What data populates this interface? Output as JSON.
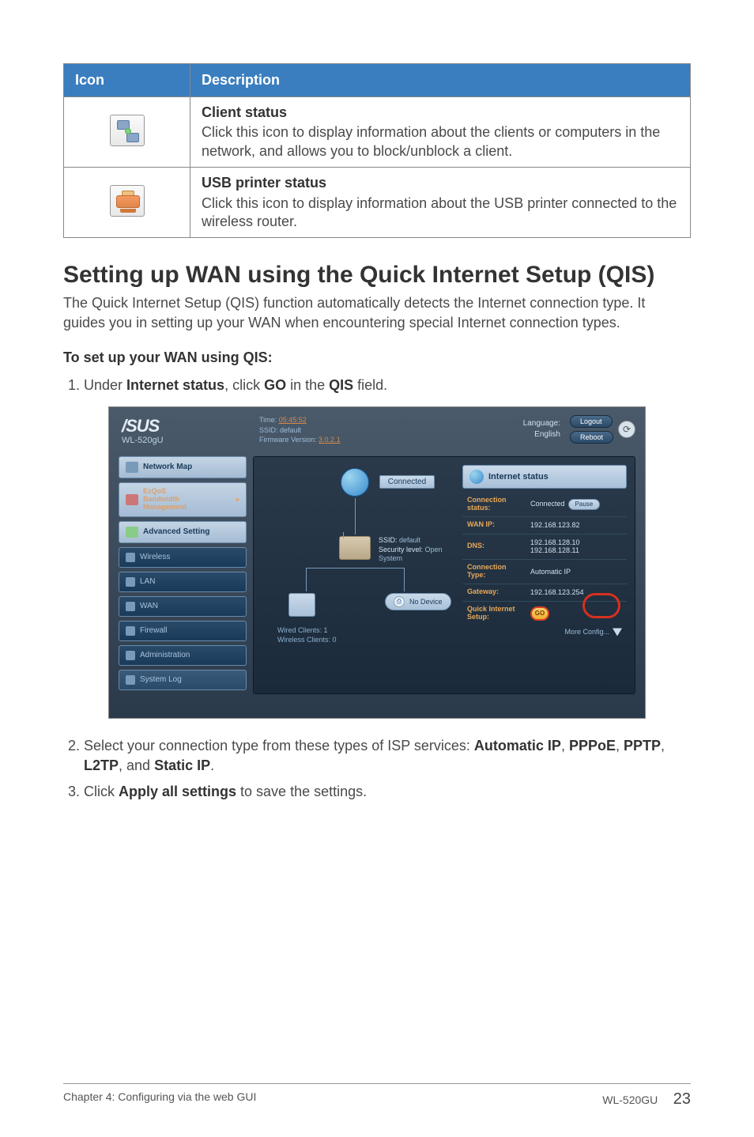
{
  "table": {
    "headers": {
      "icon": "Icon",
      "description": "Description"
    },
    "rows": [
      {
        "title": "Client status",
        "desc": "Click this icon to display information about the clients or computers in the network, and allows you to block/unblock a client."
      },
      {
        "title": "USB printer status",
        "desc": "Click this icon to display information about the USB printer connected to the wireless router."
      }
    ]
  },
  "section": {
    "title": "Setting up WAN using the Quick Internet Setup (QIS)",
    "lead": "The Quick Internet Setup (QIS) function automatically detects the Internet connection type. It guides you in setting up your WAN when encountering special Internet connection types.",
    "subhead": "To set up your WAN using QIS:"
  },
  "steps": {
    "s1_pre": "Under ",
    "s1_b1": "Internet status",
    "s1_mid": ", click ",
    "s1_b2": "GO",
    "s1_mid2": " in the ",
    "s1_b3": "QIS",
    "s1_post": " field.",
    "s2_pre": "Select your connection type from these types of ISP services: ",
    "s2_b1": "Automatic IP",
    "s2_c1": ", ",
    "s2_b2": "PPPoE",
    "s2_c2": ", ",
    "s2_b3": "PPTP",
    "s2_c3": ", ",
    "s2_b4": "L2TP",
    "s2_c4": ", and ",
    "s2_b5": "Static IP",
    "s2_post": ".",
    "s3_pre": "Click ",
    "s3_b1": "Apply all settings",
    "s3_post": " to save the settings."
  },
  "ss": {
    "logo": "/SUS",
    "model": "WL-520gU",
    "hdr_time_label": "Time:",
    "hdr_time": "05:45:52",
    "hdr_ssid_label": "SSID:",
    "hdr_ssid": "default",
    "hdr_fw_label": "Firmware Version:",
    "hdr_fw": "3.0.2.1",
    "hdr_lang_label": "Language:",
    "hdr_lang": "English",
    "btn_logout": "Logout",
    "btn_reboot": "Reboot",
    "sidebar": {
      "network_map": "Network Map",
      "ezqos_l1": "EzQoS",
      "ezqos_l2": "Bandwidth",
      "ezqos_l3": "Management",
      "adv": "Advanced Setting",
      "items": [
        "Wireless",
        "LAN",
        "WAN",
        "Firewall",
        "Administration",
        "System Log"
      ]
    },
    "map": {
      "connected": "Connected",
      "r_ssid_label": "SSID:",
      "r_ssid": "default",
      "r_sec_label": "Security level:",
      "r_sec": "Open",
      "r_sys": "System",
      "nodevice": "No Device",
      "wired_label": "Wired Clients:",
      "wired_val": "1",
      "wireless_label": "Wireless Clients:",
      "wireless_val": "0"
    },
    "status": {
      "header": "Internet status",
      "rows": {
        "conn_k": "Connection status:",
        "conn_v": "Connected",
        "conn_btn": "Pause",
        "wan_k": "WAN IP:",
        "wan_v": "192.168.123.82",
        "dns_k": "DNS:",
        "dns_v1": "192.168.128.10",
        "dns_v2": "192.168.128.11",
        "type_k": "Connection Type:",
        "type_v": "Automatic IP",
        "gw_k": "Gateway:",
        "gw_v": "192.168.123.254",
        "qis_k": "Quick Internet Setup:",
        "qis_btn": "GO"
      },
      "more": "More Config..."
    }
  },
  "footer": {
    "left": "Chapter 4: Configuring via the web GUI",
    "model": "WL-520GU",
    "page": "23"
  }
}
